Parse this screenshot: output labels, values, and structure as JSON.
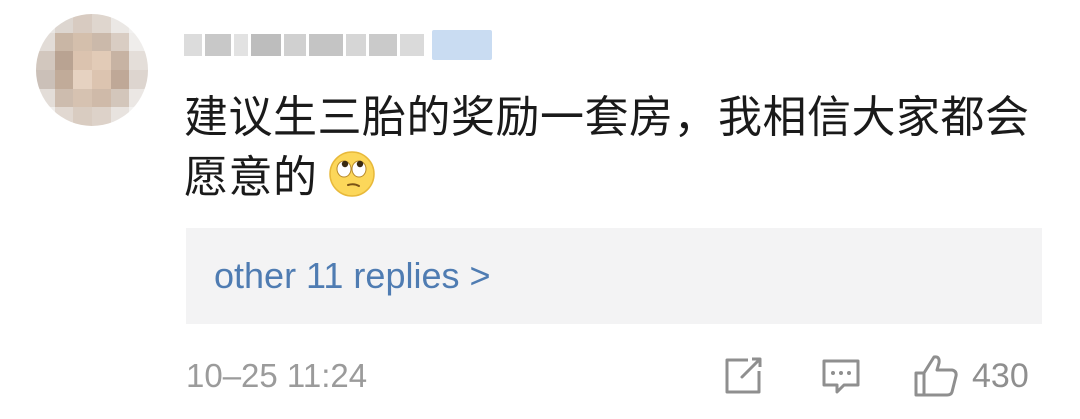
{
  "comment": {
    "text": "建议生三胎的奖励一套房，我相信大家都会愿意的",
    "emoji": "eye-roll-emoji",
    "replies_link": "other 11 replies >",
    "timestamp": "10–25 11:24",
    "like_count": "430"
  },
  "icons": {
    "share": "share-icon",
    "reply": "reply-icon",
    "like": "thumbs-up-icon"
  },
  "colors": {
    "link": "#4f7cb2",
    "meta_text": "#9b9b9b",
    "replies_bg": "#f3f3f4",
    "icon_gray": "#8f8f8f"
  }
}
